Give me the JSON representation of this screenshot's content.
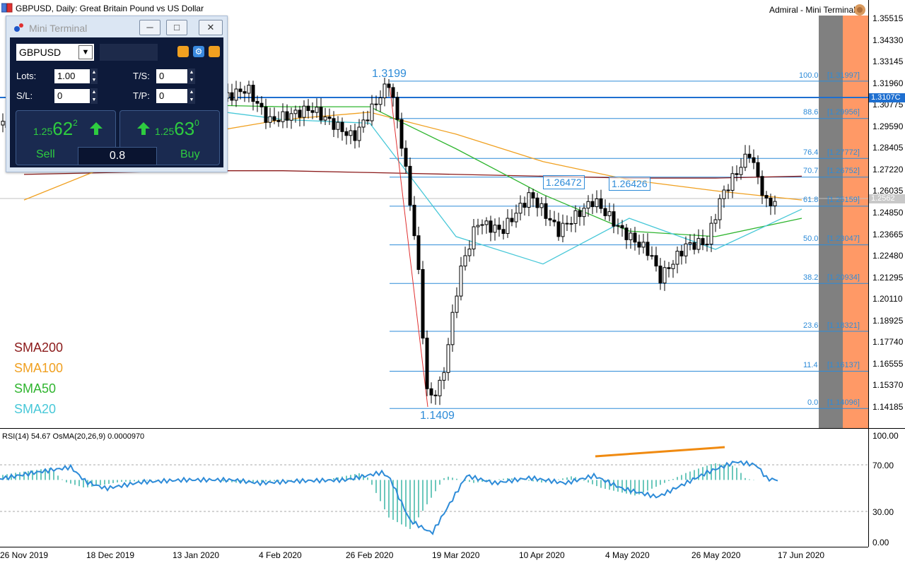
{
  "window": {
    "title": "GBPUSD, Daily:  Great Britain Pound vs US Dollar",
    "brand": "Admiral - Mini Terminal"
  },
  "mini_terminal": {
    "title": "Mini Terminal",
    "symbol": "GBPUSD",
    "lots_label": "Lots:",
    "lots_value": "1.00",
    "ts_label": "T/S:",
    "ts_value": "0",
    "sl_label": "S/L:",
    "sl_value": "0",
    "tp_label": "T/P:",
    "tp_value": "0",
    "sell": {
      "prefix": "1.25",
      "big": "62",
      "sup": "2",
      "label": "Sell"
    },
    "buy": {
      "prefix": "1.25",
      "big": "63",
      "sup": "0",
      "label": "Buy"
    },
    "spread": "0.8"
  },
  "price_axis": [
    "1.35515",
    "1.34330",
    "1.33145",
    "1.31960",
    "1.30775",
    "1.29590",
    "1.28405",
    "1.27220",
    "1.26035",
    "1.24850",
    "1.23665",
    "1.22480",
    "1.21295",
    "1.20110",
    "1.18925",
    "1.17740",
    "1.16555",
    "1.15370",
    "1.14185"
  ],
  "price_tags": {
    "resistance": "1.3107C",
    "current": "1.2562"
  },
  "time_axis": [
    "26 Nov 2019",
    "18 Dec 2019",
    "13 Jan 2020",
    "4 Feb 2020",
    "26 Feb 2020",
    "19 Mar 2020",
    "10 Apr 2020",
    "4 May 2020",
    "26 May 2020",
    "17 Jun 2020"
  ],
  "fibonacci": [
    {
      "level": "100.0",
      "value": "[1.31997]"
    },
    {
      "level": "88.6",
      "value": "[1.29956]"
    },
    {
      "level": "76.4",
      "value": "[1.27772]"
    },
    {
      "level": "70.7",
      "value": "[1.26752]"
    },
    {
      "level": "61.8",
      "value": "[1.25159]"
    },
    {
      "level": "50.0",
      "value": "[1.23047]"
    },
    {
      "level": "38.2",
      "value": "[1.20934]"
    },
    {
      "level": "23.6",
      "value": "[1.18321]"
    },
    {
      "level": "11.4",
      "value": "[1.16137]"
    },
    {
      "level": "0.0",
      "value": "[1.14096]"
    }
  ],
  "annotations": {
    "high": "1.3199",
    "low": "1.1409",
    "box1": "1.26472",
    "box2": "1.26426"
  },
  "legend": [
    {
      "name": "SMA200",
      "color": "#8b1a1a"
    },
    {
      "name": "SMA100",
      "color": "#f0a020"
    },
    {
      "name": "SMA50",
      "color": "#2fb52f"
    },
    {
      "name": "SMA20",
      "color": "#48c8d8"
    }
  ],
  "indicator": {
    "label": "RSI(14) 54.67 OsMA(20,26,9) 0.0000970",
    "axis": [
      "100.00",
      "70.00",
      "30.00",
      "0.00"
    ]
  },
  "colors": {
    "rsi": "#2d8bd8",
    "osma": "#3ab5a5",
    "fib": "#2d8bd8",
    "resistance": "#1e6fd0",
    "orange_zone": "#ff9966",
    "grey_zone": "#808080",
    "trend": "#f08a10"
  },
  "chart_data": [
    {
      "type": "candlestick",
      "title": "GBPUSD, Daily:  Great Britain Pound vs US Dollar",
      "ylim": [
        1.1345,
        1.3618
      ],
      "x": [
        "26 Nov 2019",
        "18 Dec 2019",
        "13 Jan 2020",
        "4 Feb 2020",
        "26 Feb 2020",
        "19 Mar 2020",
        "10 Apr 2020",
        "4 May 2020",
        "26 May 2020",
        "17 Jun 2020"
      ],
      "series": [
        {
          "name": "SMA200",
          "values": [
            1.269,
            1.27,
            1.271,
            1.271,
            1.27,
            1.269,
            1.268,
            1.267,
            1.267,
            1.268
          ]
        },
        {
          "name": "SMA100",
          "values": [
            1.255,
            1.274,
            1.291,
            1.299,
            1.303,
            1.291,
            1.276,
            1.266,
            1.26,
            1.255
          ]
        },
        {
          "name": "SMA50",
          "values": [
            1.295,
            1.304,
            1.307,
            1.306,
            1.306,
            1.283,
            1.258,
            1.238,
            1.235,
            1.245
          ]
        },
        {
          "name": "SMA20",
          "values": [
            1.3,
            1.308,
            1.305,
            1.299,
            1.297,
            1.235,
            1.22,
            1.245,
            1.228,
            1.25
          ]
        }
      ],
      "key_levels": {
        "high": 1.3199,
        "low": 1.1409,
        "resistance": 1.3107,
        "current": 1.2562
      }
    },
    {
      "type": "line",
      "title": "RSI(14) 54.67 OsMA(20,26,9) 0.0000970",
      "ylim": [
        0,
        100
      ],
      "x": [
        "26 Nov 2019",
        "18 Dec 2019",
        "13 Jan 2020",
        "4 Feb 2020",
        "26 Feb 2020",
        "19 Mar 2020",
        "10 Apr 2020",
        "4 May 2020",
        "26 May 2020",
        "17 Jun 2020"
      ],
      "series": [
        {
          "name": "RSI(14)",
          "values": [
            59,
            58,
            56,
            59,
            60,
            10,
            60,
            56,
            57,
            58
          ]
        }
      ]
    }
  ]
}
